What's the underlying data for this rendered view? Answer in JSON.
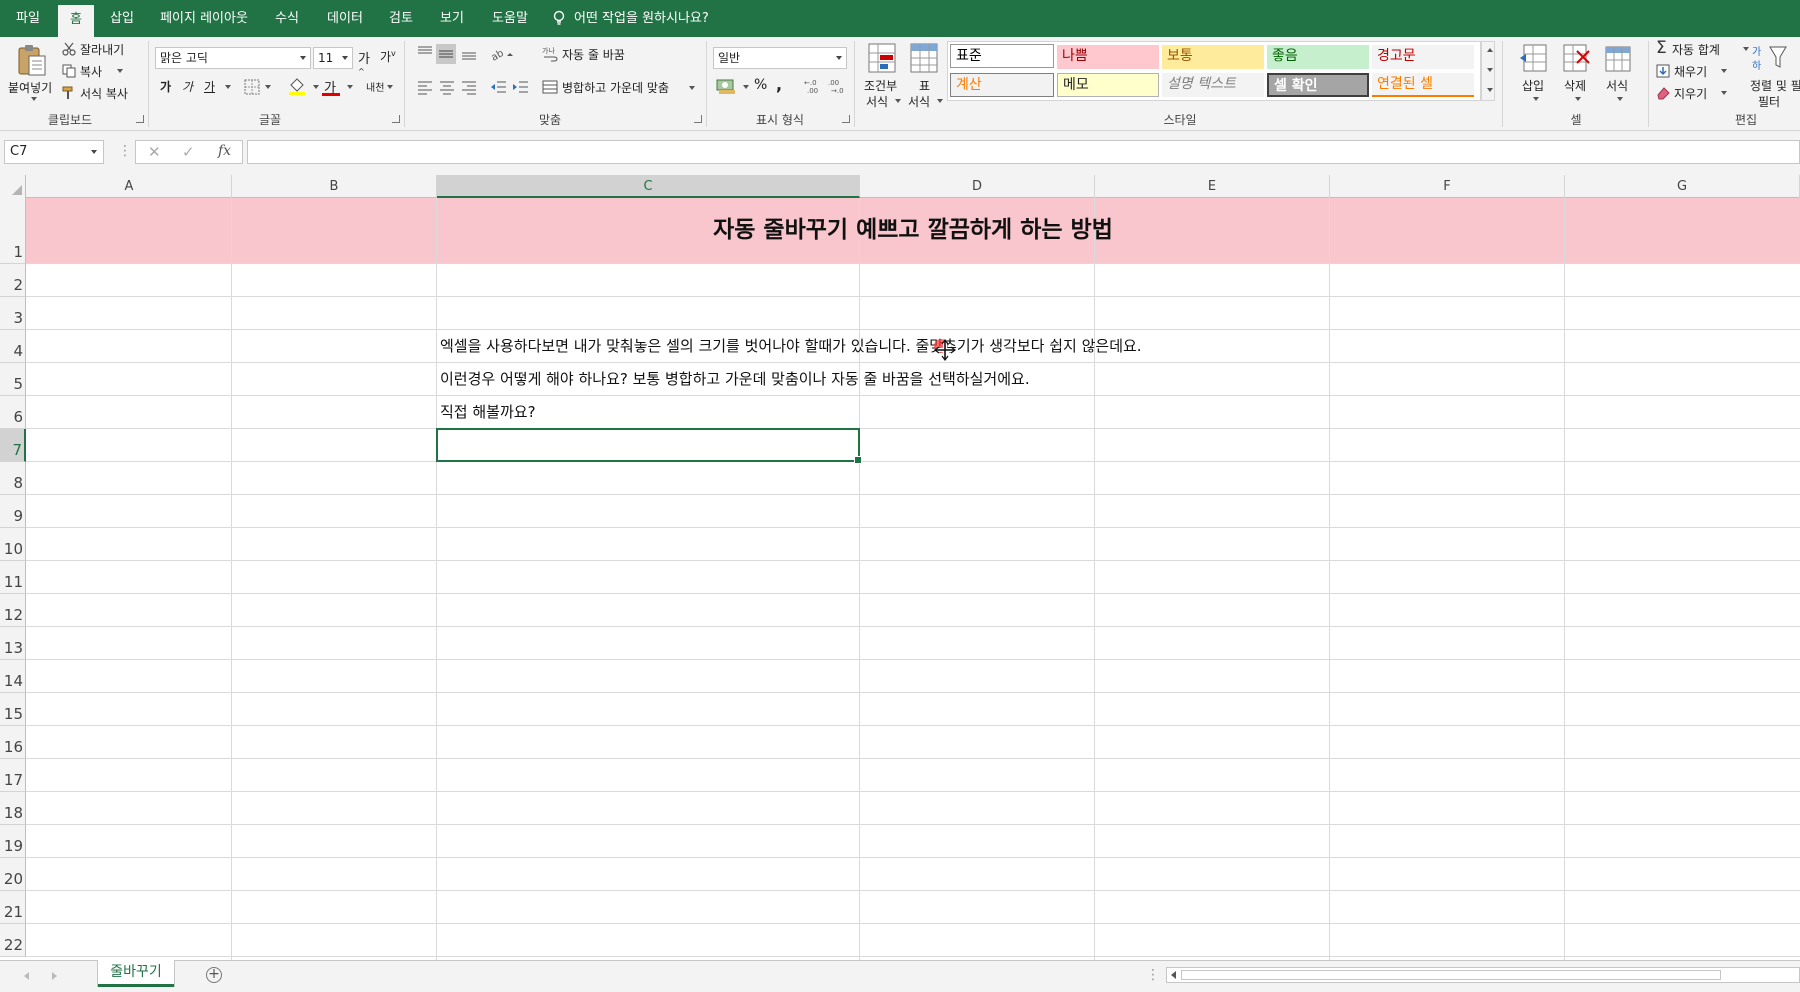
{
  "menu": {
    "tabs": [
      "파일",
      "홈",
      "삽입",
      "페이지 레이아웃",
      "수식",
      "데이터",
      "검토",
      "보기",
      "도움말"
    ],
    "tell_me": "어떤 작업을 원하시나요?"
  },
  "ribbon": {
    "clipboard": {
      "paste": "붙여넣기",
      "cut": "잘라내기",
      "copy": "복사",
      "format_painter": "서식 복사",
      "label": "클립보드"
    },
    "font": {
      "name": "맑은 고딕",
      "size": "11",
      "bold": "가",
      "italic": "가",
      "underline": "가",
      "font_color_glyph": "가",
      "phonetic": "내천",
      "label": "글꼴"
    },
    "alignment": {
      "wrap_text": "자동 줄 바꿈",
      "merge_center": "병합하고 가운데 맞춤",
      "label": "맞춤"
    },
    "number": {
      "format": "일반",
      "label": "표시 형식"
    },
    "styles": {
      "conditional": "조건부\n서식",
      "cond_line1": "조건부",
      "cond_line2": "서식",
      "format_table_line1": "표",
      "format_table_line2": "서식",
      "cells": [
        {
          "label": "표준",
          "bg": "#ffffff",
          "color": "#000000"
        },
        {
          "label": "나쁨",
          "bg": "#ffc7ce",
          "color": "#9c0006"
        },
        {
          "label": "보통",
          "bg": "#ffeb9c",
          "color": "#9c5700"
        },
        {
          "label": "좋음",
          "bg": "#c6efce",
          "color": "#006100"
        },
        {
          "label": "경고문",
          "bg": "#f3f3f3",
          "color": "#c00000"
        },
        {
          "label": "계산",
          "bg": "#f2f2f2",
          "color": "#fa7d00"
        },
        {
          "label": "메모",
          "bg": "#ffffcc",
          "color": "#222222"
        },
        {
          "label": "설명 텍스트",
          "bg": "#f3f3f3",
          "color": "#7f7f7f"
        },
        {
          "label": "셀 확인",
          "bg": "#a5a5a5",
          "color": "#ffffff"
        },
        {
          "label": "연결된 셀",
          "bg": "#f3f3f3",
          "color": "#fa7d00"
        }
      ],
      "label": "스타일"
    },
    "cells": {
      "insert": "삽입",
      "delete": "삭제",
      "format": "서식",
      "label": "셀"
    },
    "editing": {
      "autosum": "자동 합계",
      "fill": "채우기",
      "clear": "지우기",
      "sort_line1": "정렬 및 필",
      "sort_line2": "필터",
      "label": "편집"
    }
  },
  "formula_bar": {
    "name_box": "C7",
    "cancel": "✕",
    "enter": "✓",
    "fx": "fx",
    "value": ""
  },
  "sheet": {
    "columns": [
      "A",
      "B",
      "C",
      "D",
      "E",
      "F",
      "G"
    ],
    "selected_column": "C",
    "rows": [
      "1",
      "2",
      "3",
      "4",
      "5",
      "6",
      "7",
      "8",
      "9",
      "10",
      "11",
      "12",
      "13",
      "14",
      "15",
      "16",
      "17",
      "18",
      "19",
      "20",
      "21",
      "22"
    ],
    "selected_row": "7",
    "title": "자동 줄바꾸기 예쁘고 깔끔하게 하는 방법",
    "title_fill": "#f8c6cc",
    "c4": "엑셀을 사용하다보면 내가 맞춰놓은 셀의 크기를 벗어나야 할때가 있습니다. 줄맞추기가 생각보다 쉽지 않은데요.",
    "c5": "이런경우 어떻게 해야 하나요? 보통 병합하고 가운데 맞춤이나 자동 줄 바꿈을 선택하실거에요.",
    "c6": "직접 해볼까요?",
    "active_cell": "C7"
  },
  "tabs": {
    "sheet_name": "줄바꾸기",
    "add_symbol": "+"
  },
  "colors": {
    "accent": "#217346",
    "ribbon_bg": "#f3f3f3"
  }
}
